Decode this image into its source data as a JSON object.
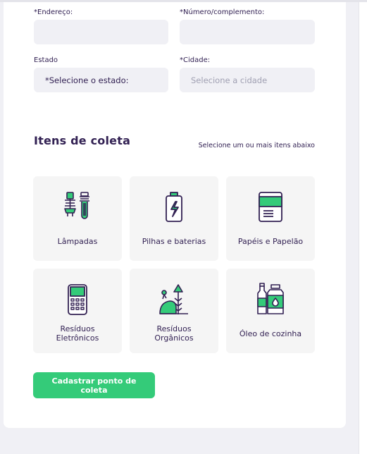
{
  "form": {
    "endereco_label": "*Endereço:",
    "numero_label": "*Número/complemento:",
    "estado_label": "Estado",
    "estado_value": "*Selecione o estado:",
    "cidade_label": "*Cidade:",
    "cidade_placeholder": "Selecione a cidade"
  },
  "items_section": {
    "title": "Itens de coleta",
    "subtitle": "Selecione um ou mais itens abaixo",
    "items": [
      {
        "label": "Lâmpadas",
        "icon": "lamp-icon"
      },
      {
        "label": "Pilhas e baterias",
        "icon": "battery-icon"
      },
      {
        "label": "Papéis e Papelão",
        "icon": "paper-icon"
      },
      {
        "label": "Resíduos Eletrônicos",
        "icon": "electronics-icon"
      },
      {
        "label": "Resíduos Orgânicos",
        "icon": "organic-icon"
      },
      {
        "label": "Óleo de cozinha",
        "icon": "oil-icon"
      }
    ]
  },
  "submit_label": "Cadastrar ponto de coleta",
  "colors": {
    "primary": "#34cb79",
    "title": "#322153",
    "input_bg": "#f0f0f5"
  }
}
